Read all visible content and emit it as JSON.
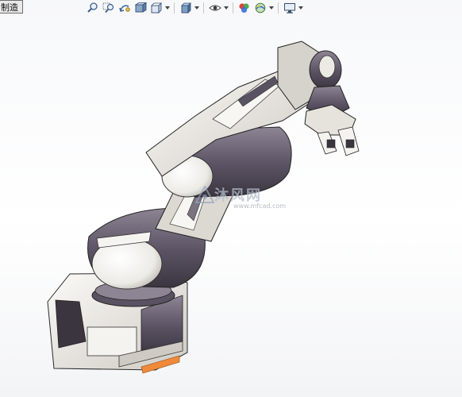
{
  "tab": {
    "label": "制造"
  },
  "toolbar": {
    "icons": [
      "zoom-to-fit-icon",
      "zoom-area-icon",
      "previous-view-icon",
      "section-view-icon",
      "view-orientation-icon",
      "display-style-icon",
      "hide-show-items-icon",
      "edit-appearance-icon",
      "apply-scene-icon",
      "view-settings-icon"
    ]
  },
  "watermark": {
    "text": "沐风网",
    "url": "www.mfcad.com"
  },
  "colors": {
    "background": "#ffffff",
    "arm_light": "#eceae4",
    "arm_dark": "#57505c",
    "base_accent": "#f08a3a"
  }
}
